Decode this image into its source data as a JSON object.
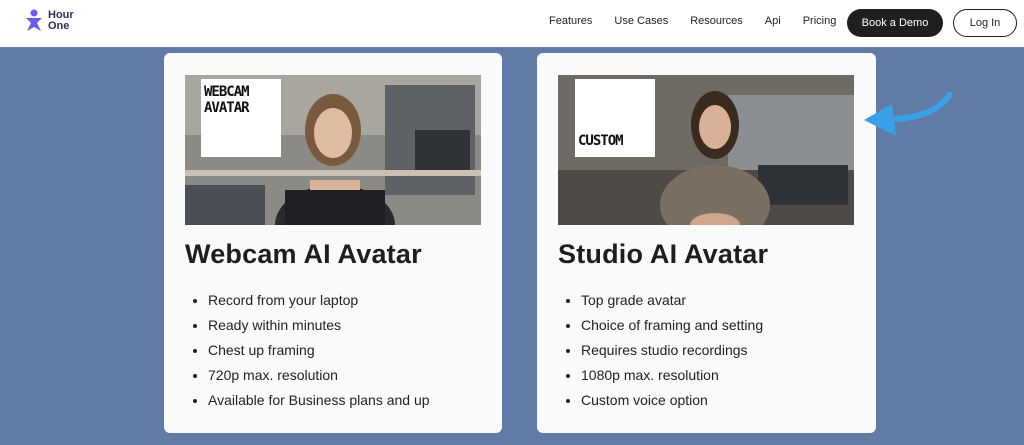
{
  "header": {
    "logo_line1": "Hour",
    "logo_line2": "One",
    "nav": [
      "Features",
      "Use Cases",
      "Resources",
      "Api",
      "Pricing"
    ],
    "cta_label": "Book a Demo",
    "login_label": "Log In"
  },
  "cards": [
    {
      "badge_line1": "WEBCAM",
      "badge_line2": "AVATAR",
      "title": "Webcam AI Avatar",
      "features": [
        "Record from your laptop",
        "Ready within minutes",
        "Chest up framing",
        "720p max. resolution",
        "Available for Business plans and up"
      ]
    },
    {
      "badge_line1": "CUSTOM",
      "title": "Studio AI Avatar",
      "features": [
        "Top grade avatar",
        "Choice of framing and setting",
        "Requires studio recordings",
        "1080p max. resolution",
        "Custom voice option"
      ]
    }
  ],
  "colors": {
    "page_bg": "#5f7ba6",
    "logo": "#6b5cf0",
    "arrow": "#3aa0e8"
  }
}
